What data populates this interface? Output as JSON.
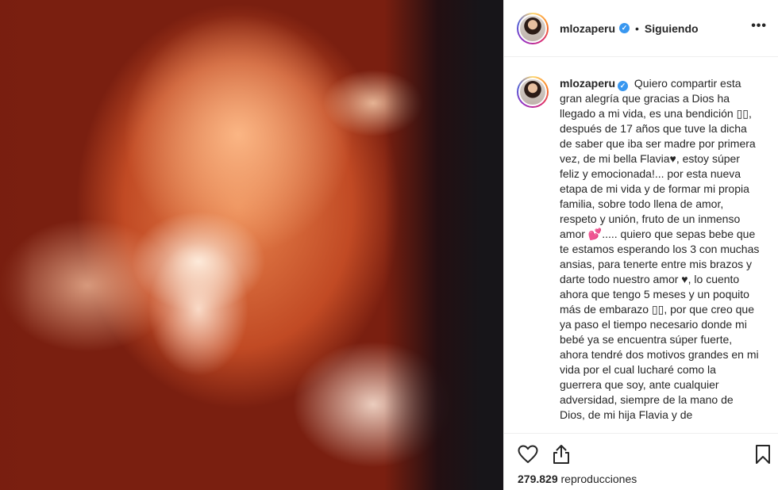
{
  "post": {
    "username": "mlozaperu",
    "verified_glyph": "✓",
    "separator": "•",
    "follow_status": "Siguiendo",
    "more_glyph": "•••",
    "caption_username": "mlozaperu",
    "caption_text": "Quiero compartir esta gran alegría que gracias a Dios ha llegado a mi vida, es una bendición ▯▯, después de 17 años que tuve la dicha de saber que iba ser madre por primera vez, de mi bella Flavia♥, estoy súper feliz y emocionada!... por esta nueva etapa de mi vida y de formar mi propia familia, sobre todo llena de amor, respeto y unión, fruto de un inmenso amor 💕..... quiero que sepas bebe que te estamos esperando los 3 con muchas ansias, para tenerte entre mis brazos y darte todo nuestro amor ♥, lo cuento ahora que tengo 5 meses y un poquito más de embarazo ▯▯, por que creo que ya paso el tiempo necesario donde mi bebé ya se encuentra súper fuerte, ahora tendré dos motivos grandes en mi vida por el cual lucharé como la guerrera que soy, ante cualquier adversidad, siempre de la mano de Dios, de mi hija Flavia y de",
    "views_count": "279.829",
    "views_label": "reproducciones"
  },
  "icons": [
    "heart-icon",
    "share-icon",
    "bookmark-icon",
    "more-icon",
    "verified-icon"
  ],
  "colors": {
    "verified": "#3897f0",
    "text": "#262626",
    "border": "#efefef"
  }
}
